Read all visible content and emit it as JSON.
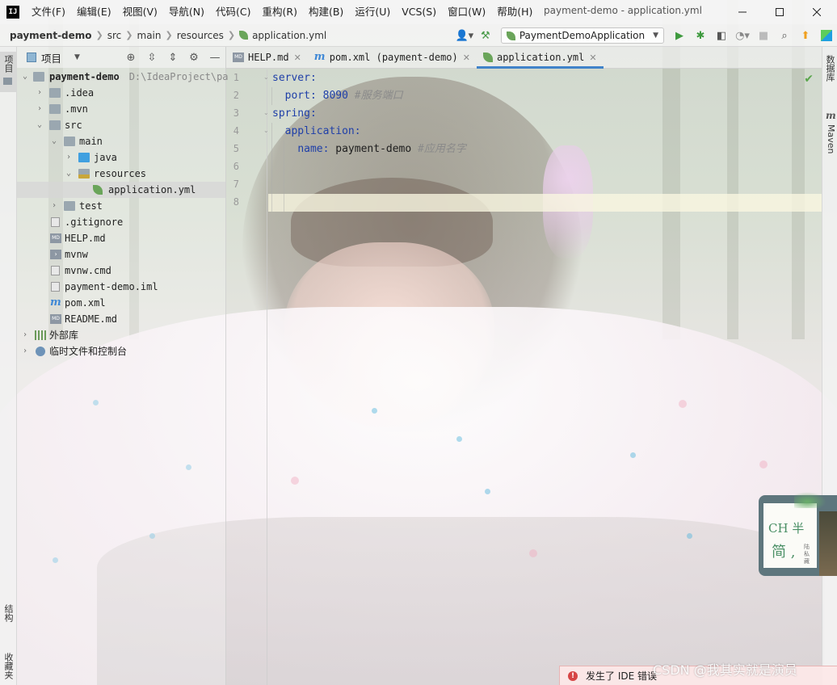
{
  "window": {
    "title": "payment-demo - application.yml",
    "logo": "IJ",
    "menu": [
      "文件(F)",
      "编辑(E)",
      "视图(V)",
      "导航(N)",
      "代码(C)",
      "重构(R)",
      "构建(B)",
      "运行(U)",
      "VCS(S)",
      "窗口(W)",
      "帮助(H)"
    ]
  },
  "breadcrumb": [
    "payment-demo",
    "src",
    "main",
    "resources",
    "application.yml"
  ],
  "run_config": "PaymentDemoApplication",
  "left_strip": {
    "project": "项目",
    "structure": "结构",
    "favorites": "收藏夹"
  },
  "right_strip": {
    "database": "数据库",
    "maven": "Maven",
    "maven_icon": "m"
  },
  "project_panel": {
    "title": "项目",
    "tree": [
      {
        "label": "payment-demo",
        "path": "D:\\IdeaProject\\pa"
      },
      {
        "label": ".idea"
      },
      {
        "label": ".mvn"
      },
      {
        "label": "src"
      },
      {
        "label": "main"
      },
      {
        "label": "java"
      },
      {
        "label": "resources"
      },
      {
        "label": "application.yml"
      },
      {
        "label": "test"
      },
      {
        "label": ".gitignore"
      },
      {
        "label": "HELP.md"
      },
      {
        "label": "mvnw"
      },
      {
        "label": "mvnw.cmd"
      },
      {
        "label": "payment-demo.iml"
      },
      {
        "label": "pom.xml"
      },
      {
        "label": "README.md"
      },
      {
        "label": "外部库"
      },
      {
        "label": "临时文件和控制台"
      }
    ]
  },
  "tabs": [
    {
      "label": "HELP.md",
      "icon": "markdown-icon"
    },
    {
      "label": "pom.xml (payment-demo)",
      "icon": "maven-icon"
    },
    {
      "label": "application.yml",
      "icon": "spring-leaf-icon"
    }
  ],
  "editor": {
    "line_numbers": [
      "1",
      "2",
      "3",
      "4",
      "5",
      "6",
      "7",
      "8"
    ],
    "code": {
      "l1_key": "server:",
      "l2_key": "port:",
      "l2_val": "8090",
      "l2_comment": "#服务端口",
      "l3_key": "spring:",
      "l4_key": "application:",
      "l5_key": "name:",
      "l5_val": "payment-demo",
      "l5_comment": "#应用名字"
    }
  },
  "sticker": {
    "line1": "CH 半",
    "line2": "简 ,",
    "line3": "陆 私 藏"
  },
  "notification": {
    "text": "发生了 IDE 错误",
    "icon": "!"
  },
  "watermark": "CSDN @我其实就是演员",
  "colors": {
    "accent": "#4083c9",
    "keyword": "#1f3fa8",
    "error": "#d64545",
    "spring": "#6aa55a"
  }
}
